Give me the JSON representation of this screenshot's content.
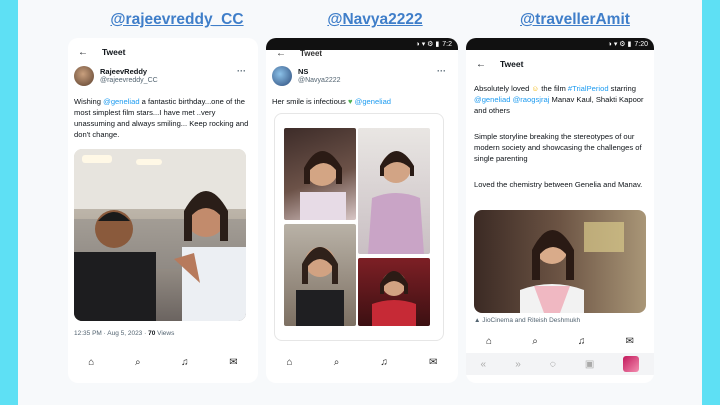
{
  "handles": [
    "@rajeevreddy_CC",
    "@Navya2222",
    "@travellerAmit"
  ],
  "panel1": {
    "header": "Tweet",
    "name": "RajeevReddy",
    "handle": "@rajeevreddy_CC",
    "text_pre": "Wishing ",
    "mention": "@geneliad",
    "text_post": " a fantastic birthday...one of the most simplest film stars...I have met ..very unassuming and always smiling... Keep rocking and don't change.",
    "time": "12:35 PM · Aug 5, 2023 · ",
    "views_count": "70",
    "views_label": " Views"
  },
  "panel2": {
    "header": "Tweet",
    "name": "NS",
    "handle": "@Navya2222",
    "text": "Her smile is infectious ",
    "mention": "@geneliad",
    "status_time": "7:2"
  },
  "panel3": {
    "header": "Tweet",
    "status_time": "7:20",
    "p1_pre": "Absolutely loved ",
    "p1_mid": " the film ",
    "hashtag": "#TrialPeriod",
    "p1_b": " starring ",
    "mention1": "@geneliad",
    "mention2": "@raogsjraj",
    "p1_end": " Manav Kaul, Shakti Kapoor and others",
    "p2": "Simple storyline breaking the stereotypes of our modern society and showcasing the challenges of single parenting",
    "p3": "Loved the chemistry between Genelia and Manav.",
    "caption": "JioCinema and Riteish Deshmukh"
  },
  "colors": {
    "handle": "#3f7ec9",
    "link": "#1d9bf0",
    "frame": "#5ee0f4"
  }
}
